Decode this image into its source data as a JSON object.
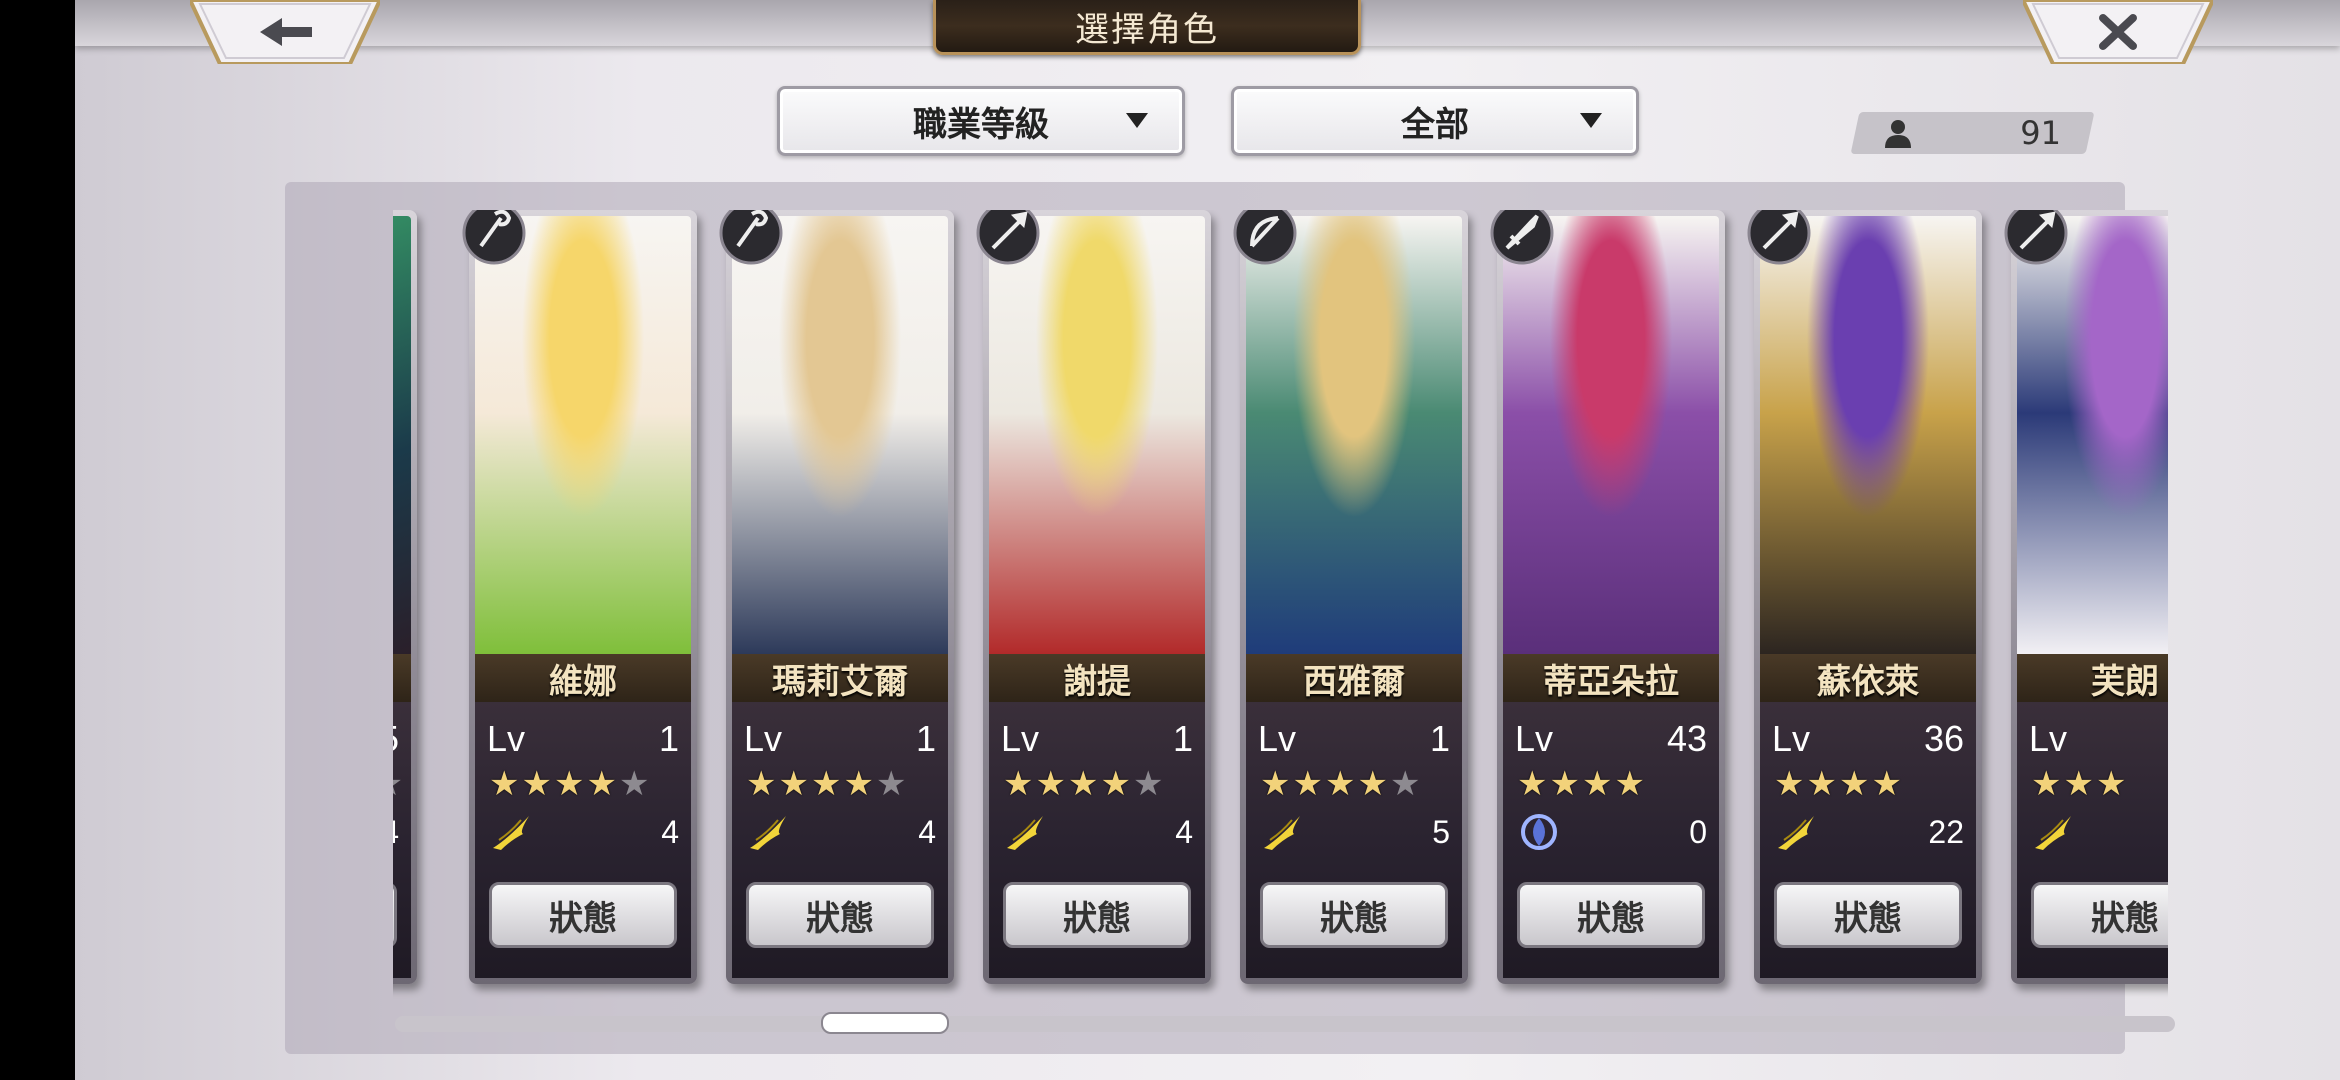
{
  "title": "選擇角色",
  "filters": {
    "class_rank": "職業等級",
    "category": "全部"
  },
  "count": "91",
  "status_label": "狀態",
  "lv_label": "Lv",
  "partial_left": {
    "lv": "5",
    "elem": "4"
  },
  "characters": [
    {
      "name": "維娜",
      "level": "1",
      "stars": 4,
      "max_stars": 5,
      "element": "wind",
      "count": "4",
      "class": "staff",
      "colors": [
        "#f6d66a",
        "#7fbf3a",
        "#f5e9d8"
      ]
    },
    {
      "name": "瑪莉艾爾",
      "level": "1",
      "stars": 4,
      "max_stars": 5,
      "element": "wind",
      "count": "4",
      "class": "staff",
      "colors": [
        "#e3c793",
        "#2d3a5a",
        "#f1eee9"
      ]
    },
    {
      "name": "謝提",
      "level": "1",
      "stars": 4,
      "max_stars": 5,
      "element": "wind",
      "count": "4",
      "class": "spear",
      "colors": [
        "#f0d96a",
        "#b22a2a",
        "#ece8e0"
      ]
    },
    {
      "name": "西雅爾",
      "level": "1",
      "stars": 4,
      "max_stars": 5,
      "element": "wind",
      "count": "5",
      "class": "bow",
      "colors": [
        "#e2c47e",
        "#1f3c7a",
        "#4a8a73"
      ]
    },
    {
      "name": "蒂亞朵拉",
      "level": "43",
      "stars": 4,
      "max_stars": 4,
      "element": "water",
      "count": "0",
      "class": "sword",
      "colors": [
        "#c93a6a",
        "#5a2f7a",
        "#8b4fa8"
      ]
    },
    {
      "name": "蘇依萊",
      "level": "36",
      "stars": 4,
      "max_stars": 4,
      "element": "wind",
      "count": "22",
      "class": "spear",
      "colors": [
        "#6a3fb0",
        "#2c2520",
        "#c8a24a"
      ]
    },
    {
      "name": "芙朗",
      "level": "",
      "stars": 3,
      "max_stars": 3,
      "element": "wind",
      "count": "",
      "class": "spear",
      "colors": [
        "#a466c8",
        "#f2f0f4",
        "#2b3a78"
      ]
    }
  ]
}
